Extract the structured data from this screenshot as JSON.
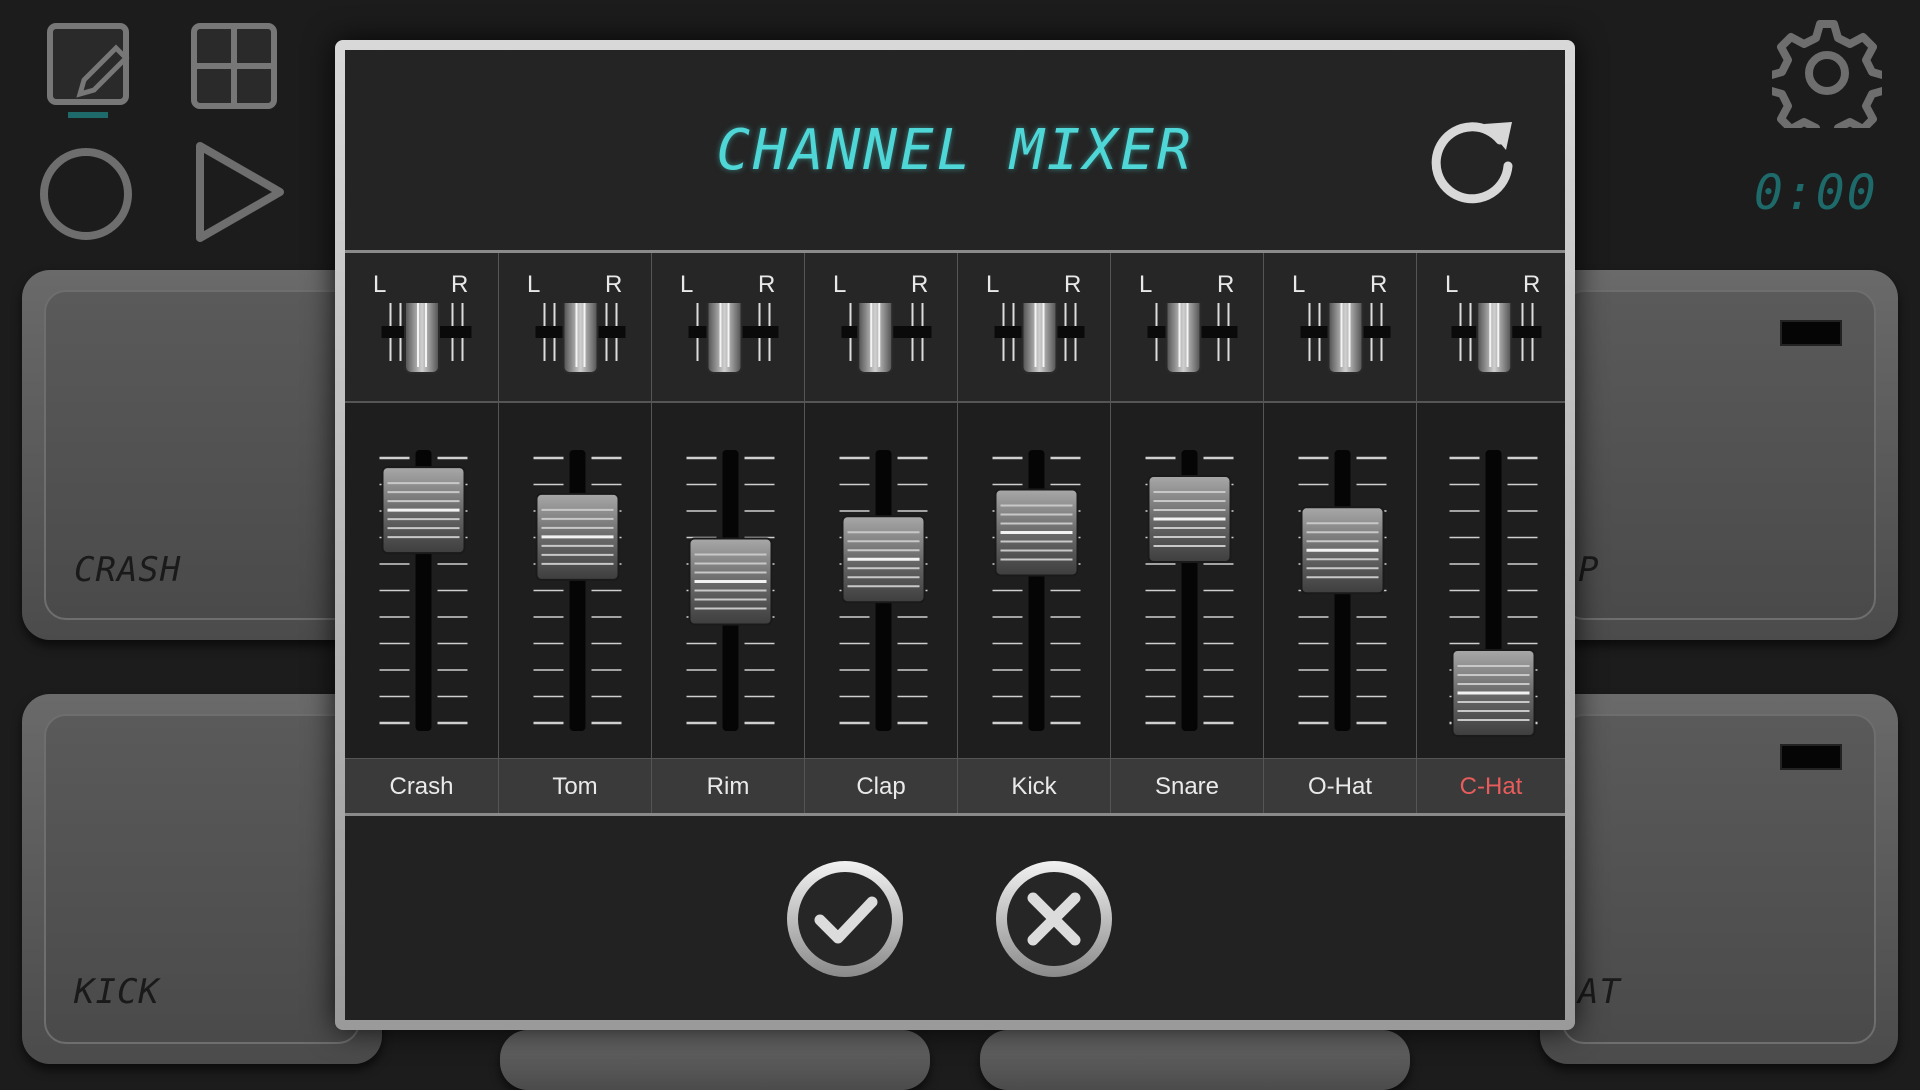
{
  "background": {
    "time": "0:00",
    "pads": [
      {
        "label": "CRASH"
      },
      {
        "label": "P"
      },
      {
        "label": "KICK"
      },
      {
        "label": "AT"
      }
    ]
  },
  "dialog": {
    "title": "CHANNEL MIXER",
    "pan_left_label": "L",
    "pan_right_label": "R",
    "channels": [
      {
        "name": "Crash",
        "pan": -0.1,
        "volume": 0.82,
        "selected": false
      },
      {
        "name": "Tom",
        "pan": 0.0,
        "volume": 0.7,
        "selected": false
      },
      {
        "name": "Rim",
        "pan": -0.2,
        "volume": 0.5,
        "selected": false
      },
      {
        "name": "Clap",
        "pan": -0.25,
        "volume": 0.6,
        "selected": false
      },
      {
        "name": "Kick",
        "pan": 0.0,
        "volume": 0.72,
        "selected": false
      },
      {
        "name": "Snare",
        "pan": -0.2,
        "volume": 0.78,
        "selected": false
      },
      {
        "name": "O-Hat",
        "pan": 0.0,
        "volume": 0.64,
        "selected": false
      },
      {
        "name": "C-Hat",
        "pan": -0.05,
        "volume": 0.0,
        "selected": true
      }
    ]
  },
  "colors": {
    "title": "#4fd6d6",
    "selected_channel": "#e85c5c",
    "time": "#1e6a6a"
  },
  "icons": [
    "edit-icon",
    "grid-icon",
    "record-icon",
    "play-icon",
    "settings-gear-icon",
    "reset-icon",
    "confirm-check-icon",
    "cancel-x-icon"
  ]
}
